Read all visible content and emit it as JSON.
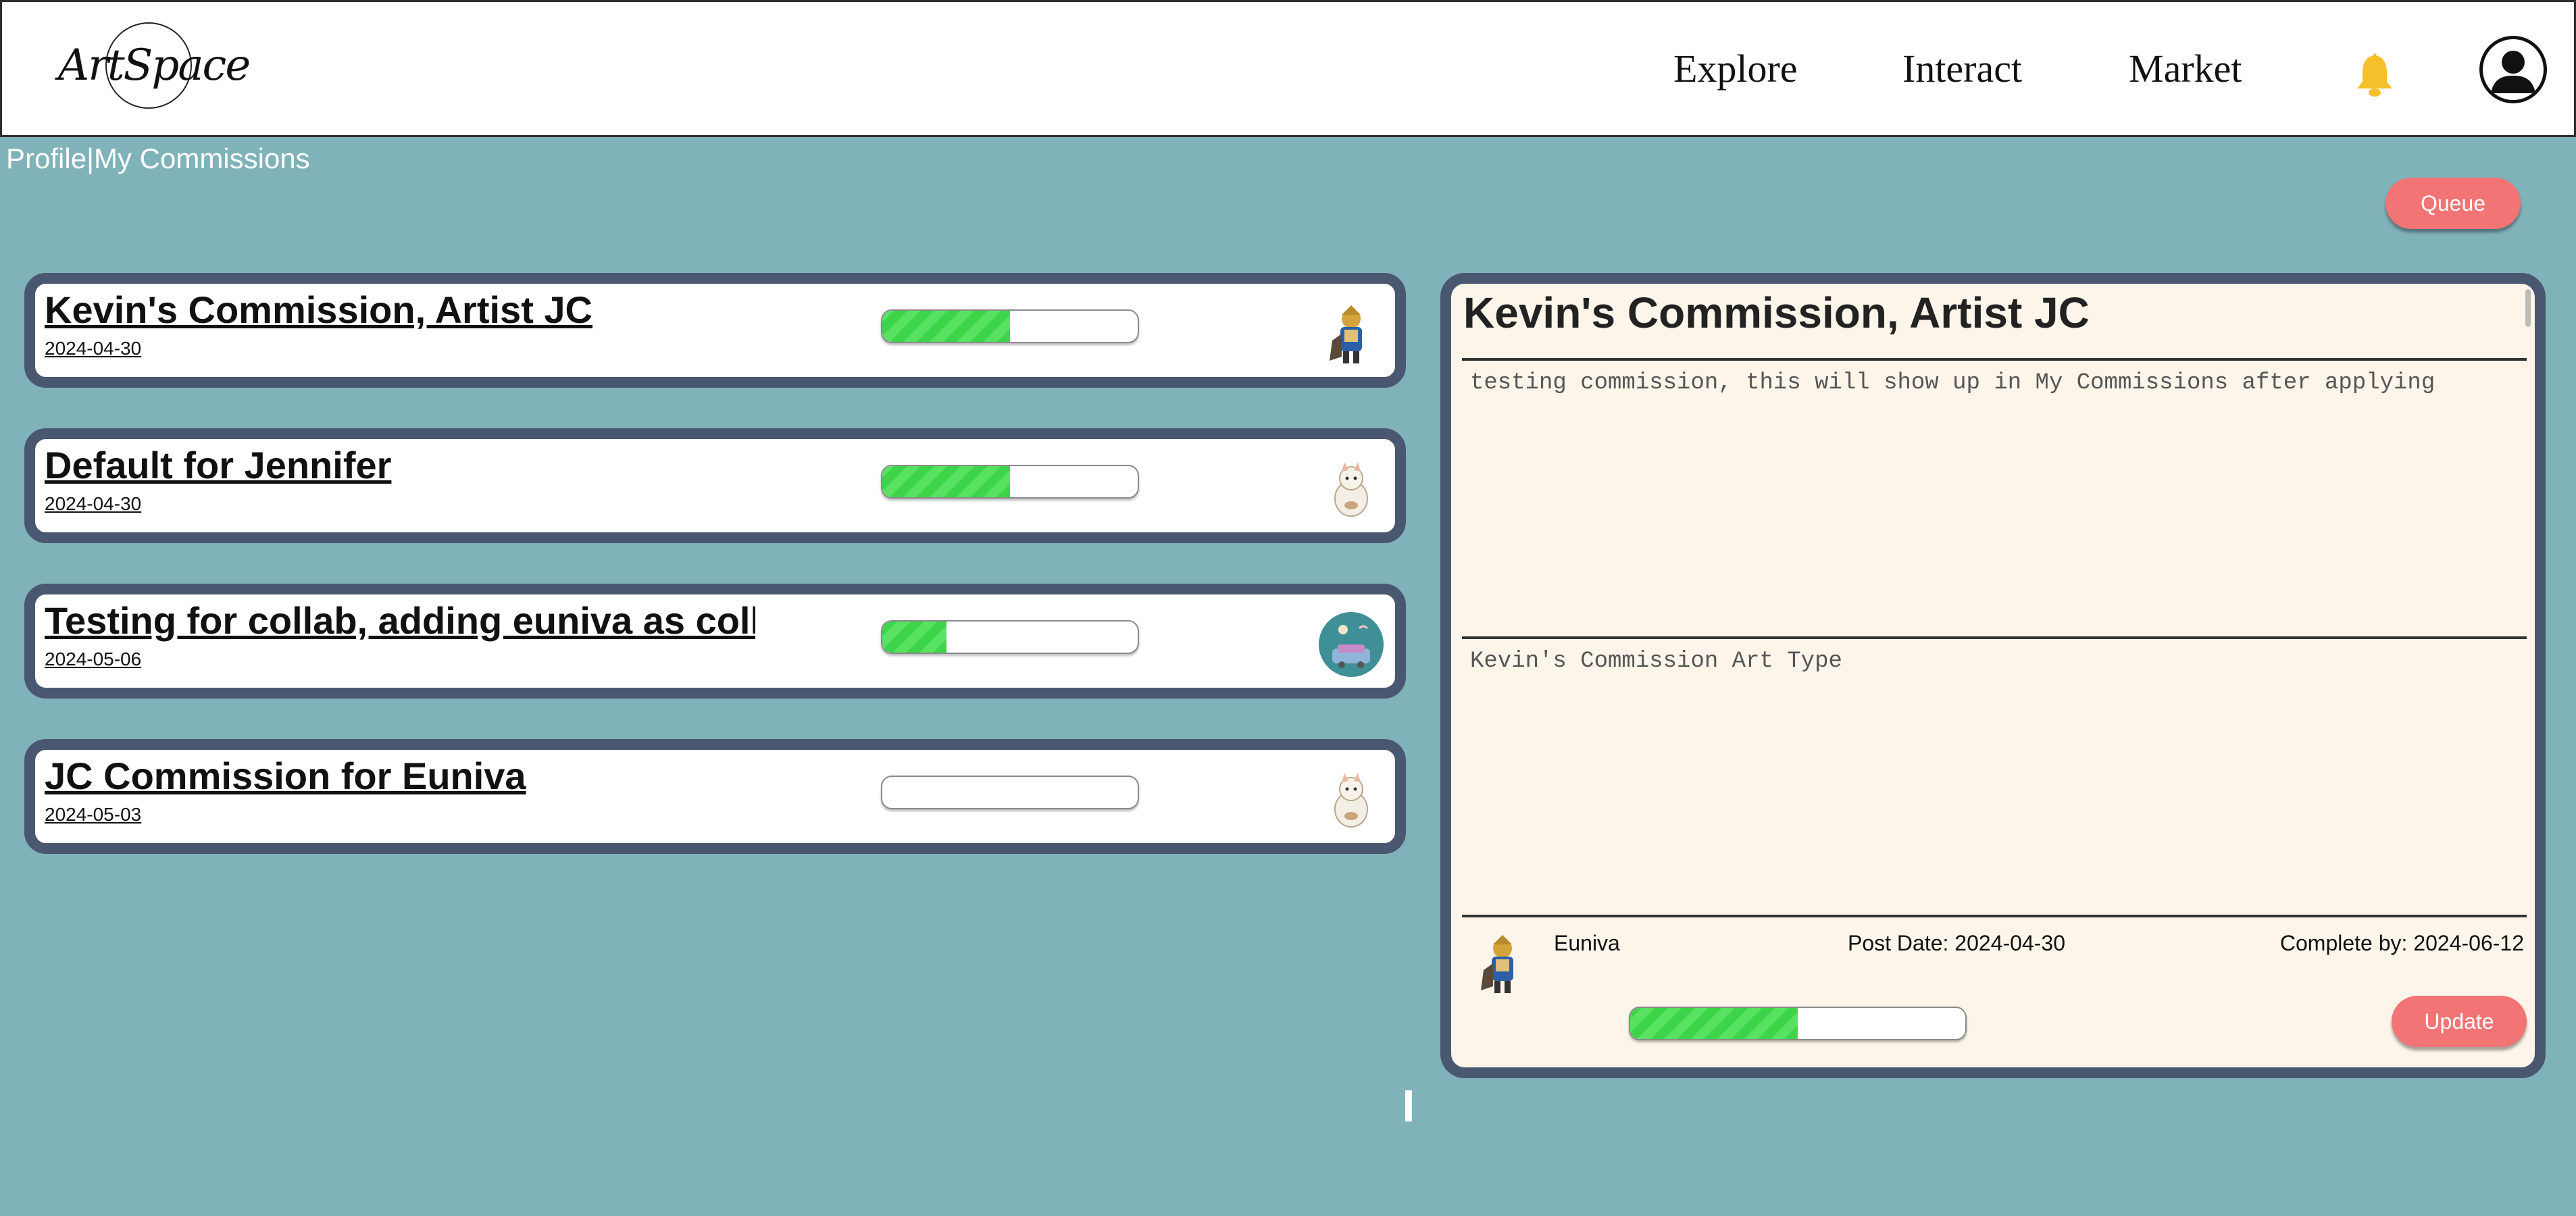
{
  "header": {
    "logo_text": "ArtSpace",
    "nav": [
      "Explore",
      "Interact",
      "Market"
    ],
    "bell_icon": "bell-icon",
    "profile_icon": "user-avatar-icon"
  },
  "colors": {
    "background": "#80b2b9",
    "card_border": "#4a5770",
    "button": "#f27474",
    "progress_fill": "#3ed44a",
    "panel_bg": "#fdf5ea",
    "bell": "#f5c02a"
  },
  "breadcrumb": {
    "profile": "Profile",
    "separator": "|",
    "current": "My Commissions"
  },
  "queue_label": "Queue",
  "commissions": [
    {
      "title": "Kevin's Commission, Artist JC",
      "date": "2024-04-30",
      "progress": 0.5,
      "thumb": "knight-character-avatar"
    },
    {
      "title": "Default for Jennifer",
      "date": "2024-04-30",
      "progress": 0.5,
      "thumb": "white-cat-avatar"
    },
    {
      "title": "Testing for collab, adding euniva as collaborator",
      "date": "2024-05-06",
      "progress": 0.25,
      "thumb": "teal-scene-avatar"
    },
    {
      "title": "JC Commission for Euniva",
      "date": "2024-05-03",
      "progress": 0,
      "thumb": "white-cat-avatar"
    }
  ],
  "detail": {
    "title": "Kevin's Commission, Artist JC",
    "description": "testing commission, this will show up in My Commissions after applying",
    "art_type": "Kevin's Commission Art Type",
    "user": "Euniva",
    "post_date": "Post Date: 2024-04-30",
    "complete_by": "Complete by: 2024-06-12",
    "progress": 0.5,
    "update_label": "Update"
  }
}
